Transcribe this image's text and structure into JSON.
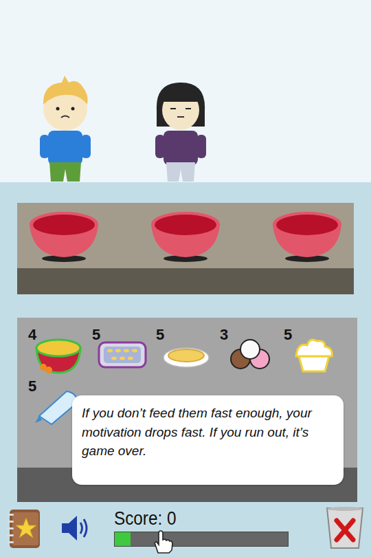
{
  "characters": [
    {
      "name": "boy",
      "kind": "sad"
    },
    {
      "name": "girl",
      "kind": "neutral"
    }
  ],
  "bowls": [
    {
      "empty": true
    },
    {
      "empty": true
    },
    {
      "empty": true
    }
  ],
  "foods": [
    {
      "count": "4",
      "kind": "pudding"
    },
    {
      "count": "5",
      "kind": "tray"
    },
    {
      "count": "5",
      "kind": "pie"
    },
    {
      "count": "3",
      "kind": "icecream"
    },
    {
      "count": "5",
      "kind": "cake"
    },
    {
      "count": "5",
      "kind": "piping"
    }
  ],
  "tooltip": "If you don’t feed them fast enough, your motivation drops fast. If you run out, it’s game over.",
  "score": {
    "label": "Score: 0",
    "level": 0.09
  }
}
